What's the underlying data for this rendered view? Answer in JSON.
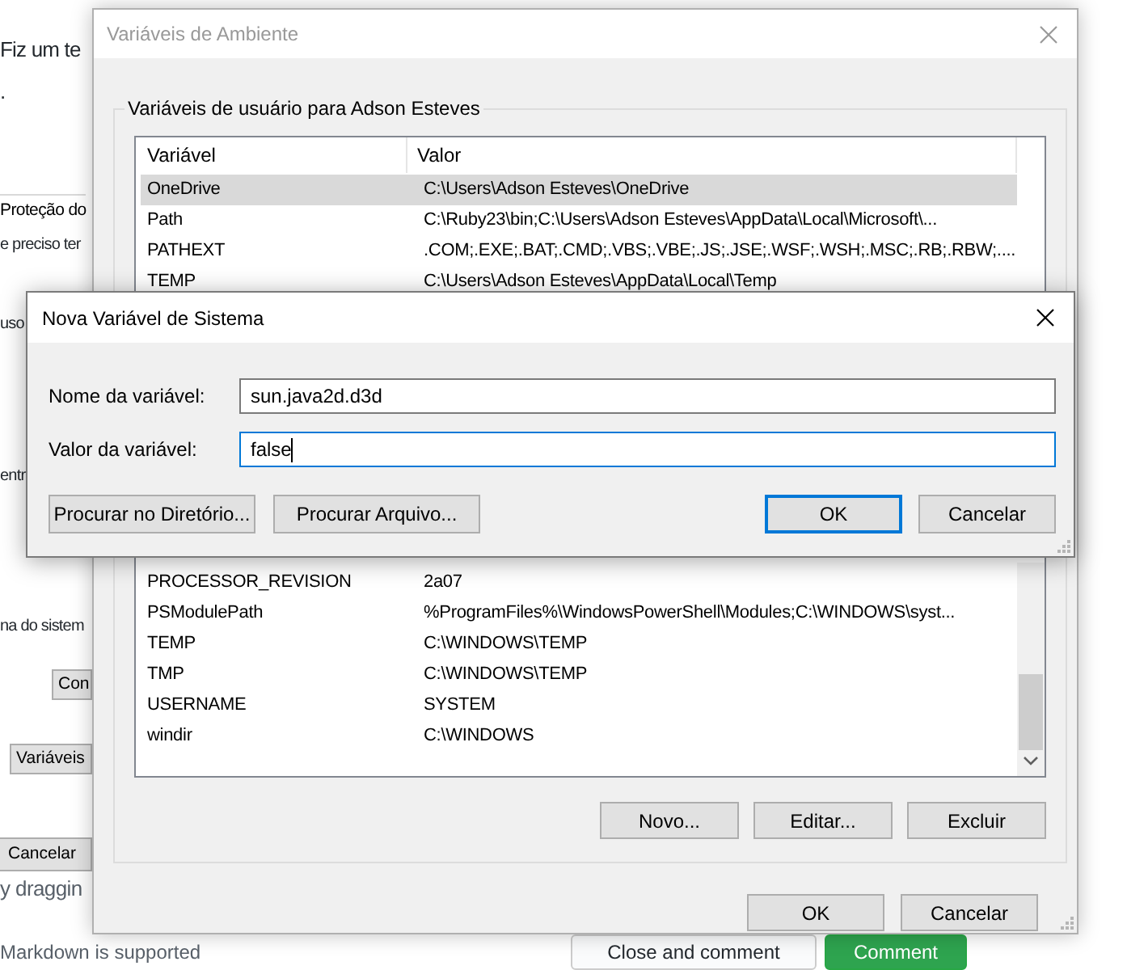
{
  "background_page": {
    "fragments": [
      {
        "kind": "heading",
        "text": "Fiz um te"
      },
      {
        "kind": "heading",
        "text": "."
      },
      {
        "kind": "tab",
        "text": "Proteção do"
      },
      {
        "kind": "text",
        "text": "e preciso ter"
      },
      {
        "kind": "text",
        "text": "uso"
      },
      {
        "kind": "text",
        "text": "entr"
      },
      {
        "kind": "text",
        "text": "na do sistem"
      },
      {
        "kind": "button",
        "text": "Con"
      },
      {
        "kind": "button",
        "text": "Variáveis"
      },
      {
        "kind": "button",
        "text": "Cancelar"
      },
      {
        "kind": "hint",
        "text": "y draggin"
      }
    ],
    "footer": {
      "note": "Markdown is supported",
      "buttons": [
        {
          "label": "Close and comment",
          "kind": "secondary"
        },
        {
          "label": "Comment",
          "kind": "primary"
        }
      ]
    }
  },
  "environment_dialog": {
    "title": "Variáveis de Ambiente",
    "active": false,
    "user_group_label": "Variáveis de usuário para Adson Esteves",
    "user_variables": {
      "columns": [
        "Variável",
        "Valor"
      ],
      "rows": [
        {
          "name": "OneDrive",
          "value": "C:\\Users\\Adson Esteves\\OneDrive",
          "selected": true
        },
        {
          "name": "Path",
          "value": "C:\\Ruby23\\bin;C:\\Users\\Adson Esteves\\AppData\\Local\\Microsoft\\...",
          "selected": false
        },
        {
          "name": "PATHEXT",
          "value": ".COM;.EXE;.BAT;.CMD;.VBS;.VBE;.JS;.JSE;.WSF;.WSH;.MSC;.RB;.RBW;....",
          "selected": false
        },
        {
          "name": "TEMP",
          "value": "C:\\Users\\Adson Esteves\\AppData\\Local\\Temp",
          "selected": false
        }
      ]
    },
    "system_variables": {
      "rows": [
        {
          "name": "PROCESSOR_REVISION",
          "value": "2a07",
          "selected": false
        },
        {
          "name": "PSModulePath",
          "value": "%ProgramFiles%\\WindowsPowerShell\\Modules;C:\\WINDOWS\\syst...",
          "selected": false
        },
        {
          "name": "TEMP",
          "value": "C:\\WINDOWS\\TEMP",
          "selected": false
        },
        {
          "name": "TMP",
          "value": "C:\\WINDOWS\\TEMP",
          "selected": false
        },
        {
          "name": "USERNAME",
          "value": "SYSTEM",
          "selected": false
        },
        {
          "name": "windir",
          "value": "C:\\WINDOWS",
          "selected": false
        }
      ]
    },
    "system_buttons": [
      "Novo...",
      "Editar...",
      "Excluir"
    ],
    "buttons": [
      "OK",
      "Cancelar"
    ]
  },
  "new_variable_dialog": {
    "title": "Nova Variável de Sistema",
    "active": true,
    "fields": [
      {
        "label": "Nome da variável:",
        "value": "sun.java2d.d3d",
        "focused": false
      },
      {
        "label": "Valor da variável:",
        "value": "false",
        "focused": true
      }
    ],
    "browse_buttons": [
      "Procurar no Diretório...",
      "Procurar Arquivo..."
    ],
    "buttons": [
      {
        "label": "OK",
        "default": true
      },
      {
        "label": "Cancelar",
        "default": false
      }
    ]
  }
}
